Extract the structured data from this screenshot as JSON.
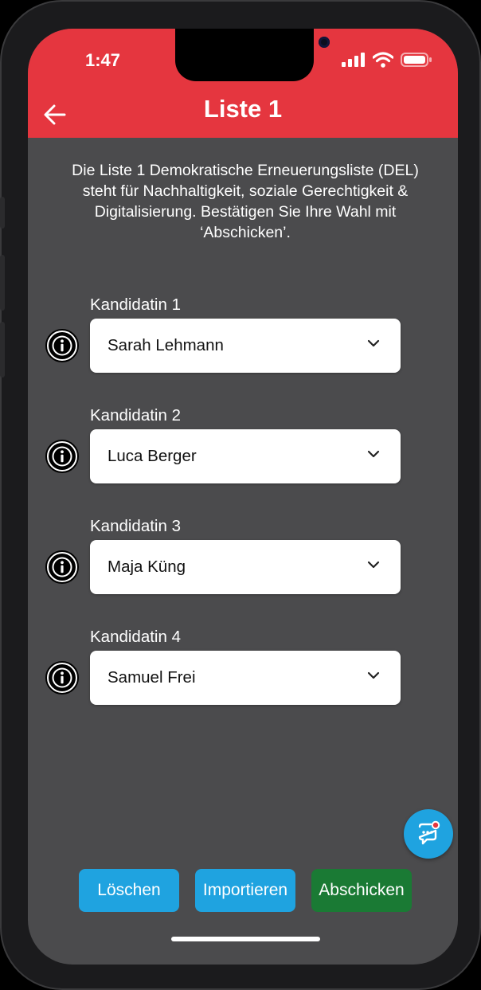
{
  "status_bar": {
    "time": "1:47"
  },
  "header": {
    "title": "Liste 1"
  },
  "intro_text": "Die Liste 1 Demokratische Erneuerungsliste (DEL) steht für Nachhaltigkeit, soziale Gerechtigkeit & Digitalisierung. Bestätigen Sie Ihre Wahl mit ‘Abschicken’.",
  "candidates": [
    {
      "label": "Kandidatin 1",
      "selected": "Sarah Lehmann"
    },
    {
      "label": "Kandidatin 2",
      "selected": "Luca Berger"
    },
    {
      "label": "Kandidatin 3",
      "selected": "Maja Küng"
    },
    {
      "label": "Kandidatin 4",
      "selected": "Samuel Frei"
    }
  ],
  "buttons": {
    "delete": "Löschen",
    "import": "Importieren",
    "submit": "Abschicken"
  },
  "colors": {
    "header": "#e5363f",
    "background": "#4b4b4d",
    "blue_button": "#1fa3e0",
    "green_button": "#1a7a34"
  },
  "icons": {
    "back": "arrow-left-icon",
    "info": "info-icon",
    "dropdown": "chevron-down-icon",
    "chat": "chat-bubble-icon"
  }
}
